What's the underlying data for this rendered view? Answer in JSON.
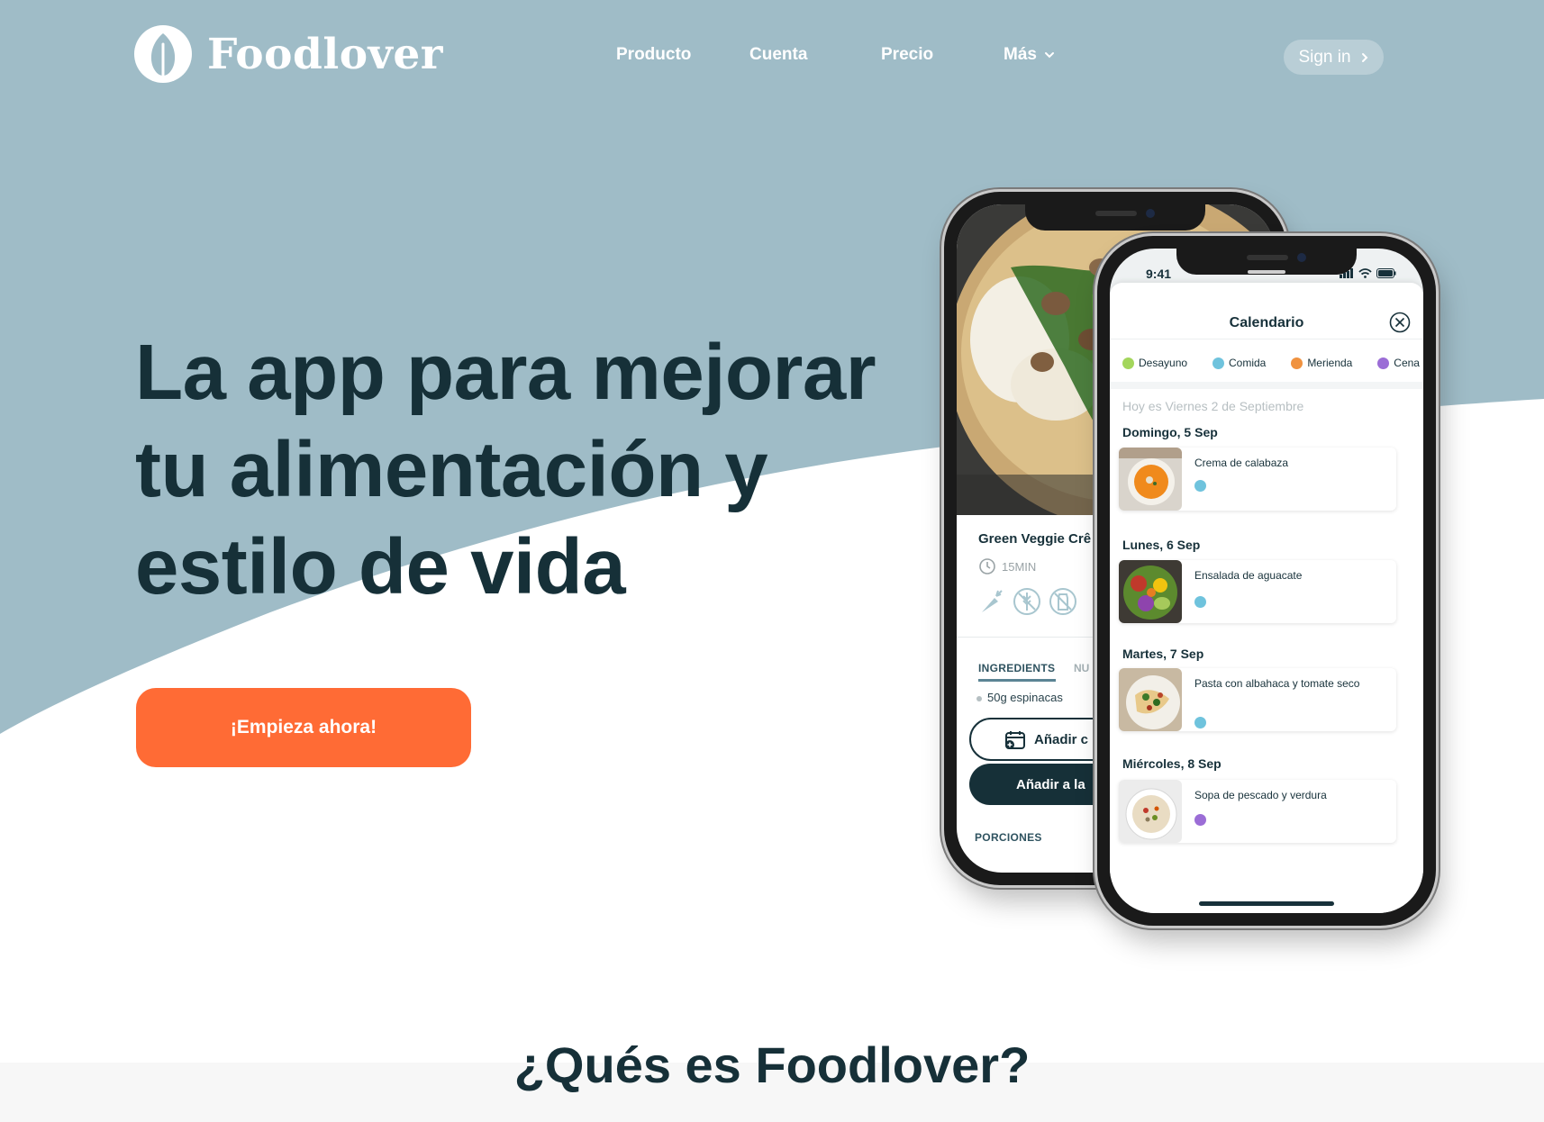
{
  "brand": {
    "name": "Foodlover"
  },
  "nav": {
    "items": [
      {
        "label": "Producto"
      },
      {
        "label": "Cuenta"
      },
      {
        "label": "Precio"
      },
      {
        "label": "Más"
      }
    ],
    "signin_label": "Sign in"
  },
  "hero": {
    "title_lines": [
      "La app para mejorar",
      "tu alimentación y",
      "estilo de vida"
    ],
    "cta_label": "¡Empieza ahora!"
  },
  "recipe_phone": {
    "recipe_name": "Green Veggie Crê",
    "time": "15MIN",
    "tabs": {
      "ingredients": "INGREDIENTS",
      "nutrition": "NU"
    },
    "ingredient": "50g espinacas",
    "add_button": "Añadir c",
    "add_list_button": "Añadir a la",
    "portions_label": "PORCIONES"
  },
  "calendar_phone": {
    "status_time": "9:41",
    "title": "Calendario",
    "legend": [
      {
        "label": "Desayuno",
        "color": "#a3d65c"
      },
      {
        "label": "Comida",
        "color": "#6fc3dd"
      },
      {
        "label": "Merienda",
        "color": "#f0923f"
      },
      {
        "label": "Cena",
        "color": "#9b6dd6"
      }
    ],
    "today": "Hoy es Viernes 2 de Septiembre",
    "days": [
      {
        "label": "Domingo, 5 Sep",
        "meal": "Crema de calabaza",
        "dot_color": "#6fc3dd"
      },
      {
        "label": "Lunes, 6 Sep",
        "meal": "Ensalada de aguacate",
        "dot_color": "#6fc3dd"
      },
      {
        "label": "Martes, 7 Sep",
        "meal": "Pasta con albahaca y tomate seco",
        "dot_color": "#6fc3dd"
      },
      {
        "label": "Miércoles, 8 Sep",
        "meal": "Sopa de pescado y verdura",
        "dot_color": "#9b6dd6"
      }
    ]
  },
  "section": {
    "title": "¿Qués es Foodlover?"
  },
  "colors": {
    "hero_bg": "#9fbcc7",
    "cta": "#ff6b35",
    "heading": "#163038"
  }
}
